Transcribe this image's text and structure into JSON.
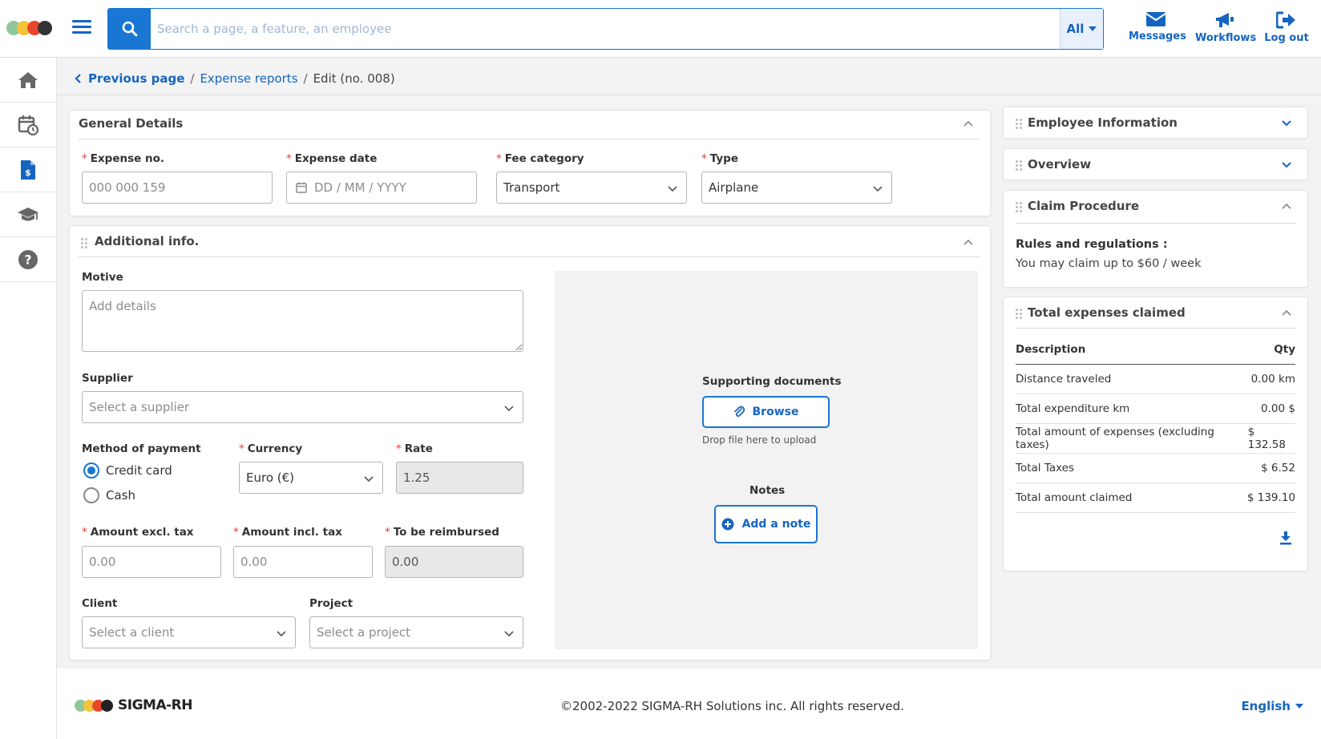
{
  "brand": {
    "logo_colors": [
      "#8fc79a",
      "#f5c33b",
      "#e8472d",
      "#333333"
    ],
    "accent": "#1976d2"
  },
  "topbar": {
    "menu_icon": "hamburger-icon",
    "search": {
      "placeholder": "Search a page, a feature, an employee",
      "scope": "All"
    },
    "actions": [
      {
        "label": "Messages",
        "icon": "envelope-icon"
      },
      {
        "label": "Workflows",
        "icon": "megaphone-icon"
      },
      {
        "label": "Log out",
        "icon": "logout-icon"
      }
    ]
  },
  "sidebar": {
    "items": [
      {
        "icon": "home-icon"
      },
      {
        "icon": "calendar-clock-icon"
      },
      {
        "icon": "expense-document-icon"
      },
      {
        "icon": "graduation-cap-icon"
      },
      {
        "icon": "help-icon"
      }
    ]
  },
  "breadcrumb": {
    "previous": "Previous page",
    "parent": "Expense reports",
    "current": "Edit (no. 008)",
    "separator": "/"
  },
  "general": {
    "title": "General Details",
    "expense_no": {
      "label": "Expense no.",
      "placeholder": "000 000 159"
    },
    "expense_date": {
      "label": "Expense date",
      "placeholder": "DD / MM / YYYY"
    },
    "fee_category": {
      "label": "Fee category",
      "value": "Transport"
    },
    "type": {
      "label": "Type",
      "value": "Airplane"
    }
  },
  "additional": {
    "title": "Additional info.",
    "motive": {
      "label": "Motive",
      "placeholder": "Add details"
    },
    "supplier": {
      "label": "Supplier",
      "placeholder": "Select a supplier"
    },
    "payment": {
      "label": "Method of payment",
      "options": [
        "Credit card",
        "Cash"
      ],
      "selected": "Credit card"
    },
    "currency": {
      "label": "Currency",
      "value": "Euro (€)"
    },
    "rate": {
      "label": "Rate",
      "value": "1.25"
    },
    "amount_excl": {
      "label": "Amount excl. tax",
      "placeholder": "0.00"
    },
    "amount_incl": {
      "label": "Amount incl. tax",
      "placeholder": "0.00"
    },
    "to_reimburse": {
      "label": "To be reimbursed",
      "value": "0.00"
    },
    "client": {
      "label": "Client",
      "placeholder": "Select a client"
    },
    "project": {
      "label": "Project",
      "placeholder": "Select a project"
    },
    "docs": {
      "title": "Supporting documents",
      "browse": "Browse",
      "hint": "Drop file here to upload"
    },
    "notes": {
      "title": "Notes",
      "add": "Add a note"
    }
  },
  "right": {
    "employee_info": "Employee Information",
    "overview": "Overview",
    "claim": {
      "title": "Claim Procedure",
      "rules_title": "Rules and regulations :",
      "rules_text": "You may claim up to $60 / week"
    },
    "totals": {
      "title": "Total expenses claimed",
      "head": {
        "description": "Description",
        "qty": "Qty"
      },
      "rows": [
        {
          "description": "Distance traveled",
          "qty": "0.00 km"
        },
        {
          "description": "Total expenditure km",
          "qty": "0.00 $"
        },
        {
          "description": "Total amount of expenses (excluding taxes)",
          "qty": "$ 132.58"
        },
        {
          "description": "Total Taxes",
          "qty": "$ 6.52"
        },
        {
          "description": "Total amount claimed",
          "qty": "$ 139.10"
        }
      ],
      "download_icon": "download-icon"
    }
  },
  "footer": {
    "brand": "SIGMA-RH",
    "copyright": "©2002-2022 SIGMA-RH Solutions inc. All rights reserved.",
    "language": "English"
  }
}
